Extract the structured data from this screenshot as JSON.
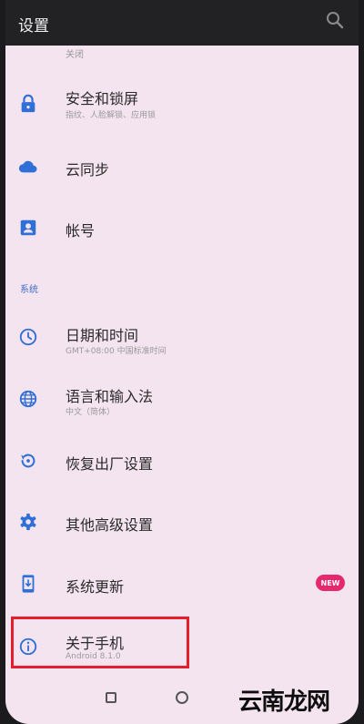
{
  "header": {
    "title": "设置"
  },
  "partial_item_sub": "关闭",
  "section_system_label": "系统",
  "items": [
    {
      "title": "安全和锁屏",
      "subtitle": "指纹、人脸解锁、应用锁",
      "icon": "lock-icon"
    },
    {
      "title": "云同步",
      "subtitle": "",
      "icon": "cloud-icon"
    },
    {
      "title": "帐号",
      "subtitle": "",
      "icon": "account-icon"
    },
    {
      "title": "日期和时间",
      "subtitle": "GMT+08:00 中国标准时间",
      "icon": "clock-icon"
    },
    {
      "title": "语言和输入法",
      "subtitle": "中文（简体）",
      "icon": "globe-icon"
    },
    {
      "title": "恢复出厂设置",
      "subtitle": "",
      "icon": "restore-icon"
    },
    {
      "title": "其他高级设置",
      "subtitle": "",
      "icon": "gear-icon"
    },
    {
      "title": "系统更新",
      "subtitle": "",
      "icon": "system-update-icon",
      "badge": "NEW"
    },
    {
      "title": "关于手机",
      "subtitle": "Android 8.1.0",
      "icon": "info-icon"
    }
  ],
  "watermark": "云南龙网",
  "colors": {
    "icon_blue": "#2f6fd6",
    "badge": "#e6296c",
    "highlight": "#e21f2a",
    "background": "#f4e4ef"
  }
}
